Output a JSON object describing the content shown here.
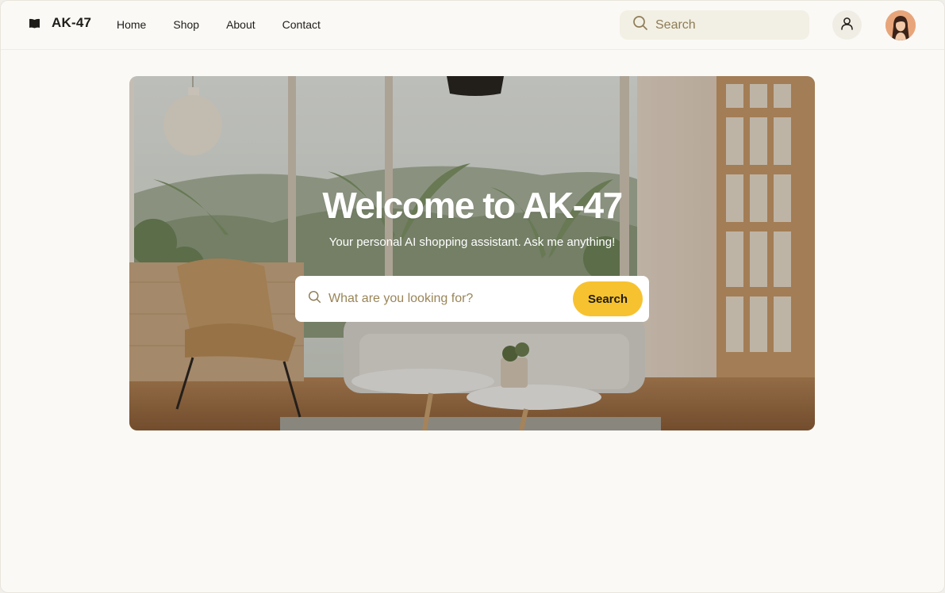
{
  "header": {
    "brand": "AK-47",
    "nav": [
      {
        "label": "Home"
      },
      {
        "label": "Shop"
      },
      {
        "label": "About"
      },
      {
        "label": "Contact"
      }
    ],
    "search_placeholder": "Search",
    "user_icon": "user-icon",
    "avatar": "user-avatar"
  },
  "hero": {
    "title": "Welcome to AK-47",
    "subtitle": "Your personal AI shopping assistant. Ask me anything!",
    "search_placeholder": "What are you looking for?",
    "search_button": "Search"
  },
  "colors": {
    "background": "#faf9f5",
    "accent": "#f7c230",
    "search_bg": "#f2efe4",
    "placeholder": "#8e7c55"
  }
}
